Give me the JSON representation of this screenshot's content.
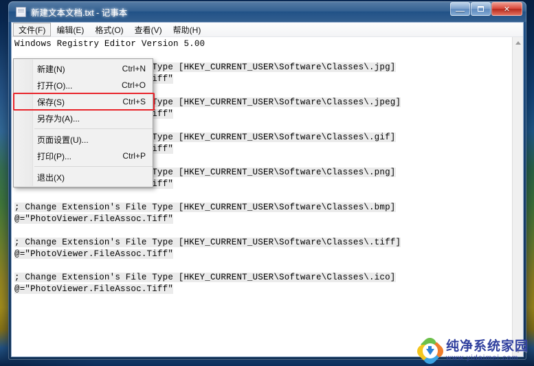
{
  "window": {
    "title": "新建文本文档.txt - 记事本",
    "icon": "notepad-icon",
    "controls": {
      "minimize": "—",
      "maximize": "□",
      "close": "✕"
    }
  },
  "menubar": {
    "items": [
      {
        "label": "文件(F)",
        "active": true
      },
      {
        "label": "编辑(E)",
        "active": false
      },
      {
        "label": "格式(O)",
        "active": false
      },
      {
        "label": "查看(V)",
        "active": false
      },
      {
        "label": "帮助(H)",
        "active": false
      }
    ]
  },
  "file_menu": {
    "items": [
      {
        "label": "新建(N)",
        "accel": "Ctrl+N",
        "highlighted": false
      },
      {
        "label": "打开(O)...",
        "accel": "Ctrl+O",
        "highlighted": false
      },
      {
        "label": "保存(S)",
        "accel": "Ctrl+S",
        "highlighted": true
      },
      {
        "label": "另存为(A)...",
        "accel": "",
        "highlighted": false
      },
      {
        "label": "页面设置(U)...",
        "accel": "",
        "highlighted": false
      },
      {
        "label": "打印(P)...",
        "accel": "Ctrl+P",
        "highlighted": false
      },
      {
        "label": "退出(X)",
        "accel": "",
        "highlighted": false
      }
    ],
    "annotation_color": "#e8232a",
    "annotated_item": "保存(S)"
  },
  "editor": {
    "lines": [
      {
        "text": "Windows Registry Editor Version 5.00",
        "highlight": false
      },
      {
        "text": "",
        "highlight": false
      },
      {
        "text": "; Change Extension's File Type [HKEY_CURRENT_USER\\Software\\Classes\\.jpg]",
        "highlight": true
      },
      {
        "text": "@=\"PhotoViewer.FileAssoc.Tiff\"",
        "highlight": true
      },
      {
        "text": "",
        "highlight": false
      },
      {
        "text": "; Change Extension's File Type [HKEY_CURRENT_USER\\Software\\Classes\\.jpeg]",
        "highlight": true
      },
      {
        "text": "@=\"PhotoViewer.FileAssoc.Tiff\"",
        "highlight": true
      },
      {
        "text": "",
        "highlight": false
      },
      {
        "text": "; Change Extension's File Type [HKEY_CURRENT_USER\\Software\\Classes\\.gif]",
        "highlight": true
      },
      {
        "text": "@=\"PhotoViewer.FileAssoc.Tiff\"",
        "highlight": true
      },
      {
        "text": "",
        "highlight": false
      },
      {
        "text": "; Change Extension's File Type [HKEY_CURRENT_USER\\Software\\Classes\\.png]",
        "highlight": true
      },
      {
        "text": "@=\"PhotoViewer.FileAssoc.Tiff\"",
        "highlight": true
      },
      {
        "text": "",
        "highlight": false
      },
      {
        "text": "; Change Extension's File Type [HKEY_CURRENT_USER\\Software\\Classes\\.bmp]",
        "highlight": true
      },
      {
        "text": "@=\"PhotoViewer.FileAssoc.Tiff\"",
        "highlight": true
      },
      {
        "text": "",
        "highlight": false
      },
      {
        "text": "; Change Extension's File Type [HKEY_CURRENT_USER\\Software\\Classes\\.tiff]",
        "highlight": true
      },
      {
        "text": "@=\"PhotoViewer.FileAssoc.Tiff\"",
        "highlight": true
      },
      {
        "text": "",
        "highlight": false
      },
      {
        "text": "; Change Extension's File Type [HKEY_CURRENT_USER\\Software\\Classes\\.ico]",
        "highlight": true
      },
      {
        "text": "@=\"PhotoViewer.FileAssoc.Tiff\"",
        "highlight": true
      }
    ]
  },
  "scrollbar": {
    "up_arrow": "scroll-up-icon",
    "down_arrow": "scroll-down-icon"
  },
  "watermark": {
    "title": "纯净系统家园",
    "url": "www.yidaimei.com",
    "logo": "flower-download-logo"
  }
}
